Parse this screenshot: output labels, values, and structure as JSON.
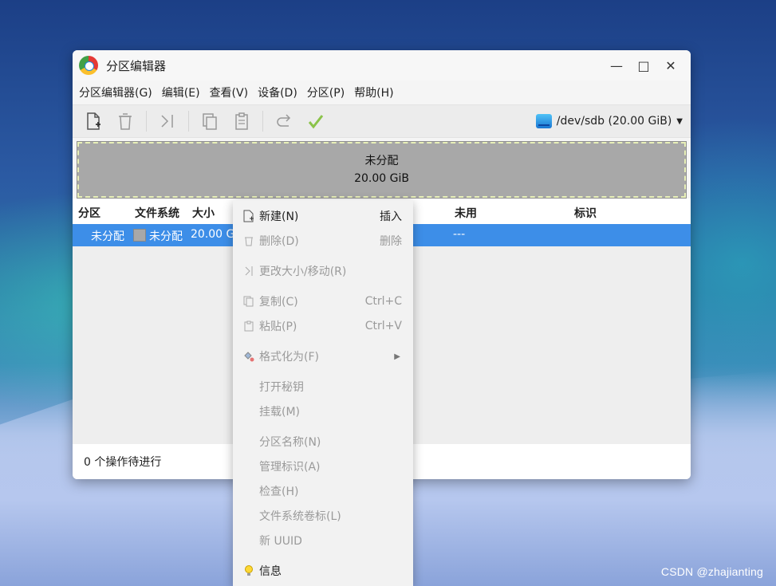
{
  "window": {
    "title": "分区编辑器"
  },
  "menubar": [
    "分区编辑器(G)",
    "编辑(E)",
    "查看(V)",
    "设备(D)",
    "分区(P)",
    "帮助(H)"
  ],
  "toolbar": {
    "icons": [
      "new-partition-icon",
      "delete-icon",
      "resize-icon",
      "copy-icon",
      "paste-icon",
      "undo-icon",
      "apply-icon"
    ],
    "device": "/dev/sdb (20.00 GiB)"
  },
  "graph": {
    "label": "未分配",
    "size": "20.00 GiB"
  },
  "table": {
    "headers": {
      "partition": "分区",
      "filesystem": "文件系统",
      "size": "大小",
      "unused": "未用",
      "flags": "标识"
    },
    "row": {
      "partition": "未分配",
      "filesystem": "未分配",
      "size": "20.00 Gi",
      "unused": "---"
    }
  },
  "status": "0 个操作待进行",
  "context_menu": [
    {
      "label": "新建(N)",
      "shortcut": "插入",
      "enabled": true
    },
    {
      "label": "删除(D)",
      "shortcut": "删除",
      "enabled": false
    },
    {
      "label": "更改大小/移动(R)",
      "shortcut": "",
      "enabled": false
    },
    {
      "label": "复制(C)",
      "shortcut": "Ctrl+C",
      "enabled": false
    },
    {
      "label": "粘贴(P)",
      "shortcut": "Ctrl+V",
      "enabled": false
    },
    {
      "label": "格式化为(F)",
      "shortcut": "",
      "enabled": false
    },
    {
      "label": "打开秘钥",
      "shortcut": "",
      "enabled": false
    },
    {
      "label": "挂载(M)",
      "shortcut": "",
      "enabled": false
    },
    {
      "label": "分区名称(N)",
      "shortcut": "",
      "enabled": false
    },
    {
      "label": "管理标识(A)",
      "shortcut": "",
      "enabled": false
    },
    {
      "label": "检查(H)",
      "shortcut": "",
      "enabled": false
    },
    {
      "label": "文件系统卷标(L)",
      "shortcut": "",
      "enabled": false
    },
    {
      "label": "新 UUID",
      "shortcut": "",
      "enabled": false
    },
    {
      "label": "信息",
      "shortcut": "",
      "enabled": true
    }
  ],
  "watermark": "CSDN @zhajianting"
}
